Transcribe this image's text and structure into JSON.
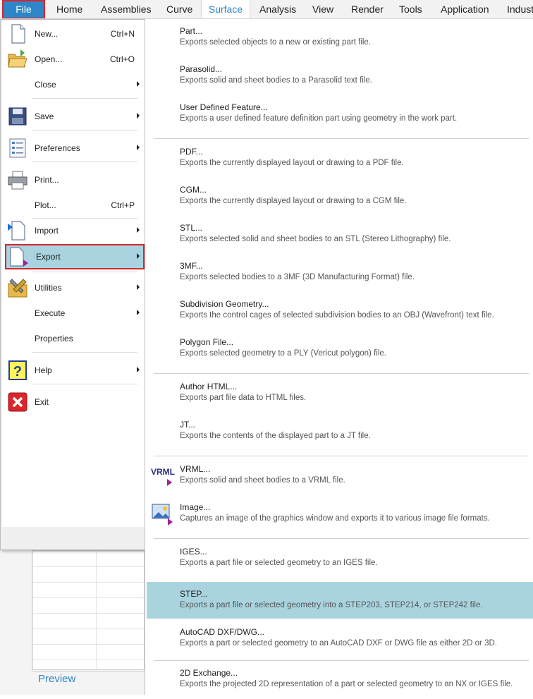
{
  "ribbon": {
    "tabs": [
      {
        "label": "File"
      },
      {
        "label": "Home"
      },
      {
        "label": "Assemblies"
      },
      {
        "label": "Curve"
      },
      {
        "label": "Surface"
      },
      {
        "label": "Analysis"
      },
      {
        "label": "View"
      },
      {
        "label": "Render"
      },
      {
        "label": "Tools"
      },
      {
        "label": "Application"
      },
      {
        "label": "Indust"
      }
    ]
  },
  "file_menu": {
    "items": [
      {
        "label": "New...",
        "shortcut": "Ctrl+N"
      },
      {
        "label": "Open...",
        "shortcut": "Ctrl+O"
      },
      {
        "label": "Close"
      },
      {
        "label": "Save"
      },
      {
        "label": "Preferences"
      },
      {
        "label": "Print..."
      },
      {
        "label": "Plot...",
        "shortcut": "Ctrl+P"
      },
      {
        "label": "Import"
      },
      {
        "label": "Export"
      },
      {
        "label": "Utilities"
      },
      {
        "label": "Execute"
      },
      {
        "label": "Properties"
      },
      {
        "label": "Help"
      },
      {
        "label": "Exit"
      }
    ]
  },
  "export_menu": {
    "items": [
      {
        "title": "Part...",
        "desc": "Exports selected objects to a new or existing part file."
      },
      {
        "title": "Parasolid...",
        "desc": "Exports solid and sheet bodies to a Parasolid text file."
      },
      {
        "title": "User Defined Feature...",
        "desc": "Exports a user defined feature definition part using geometry in the work part."
      },
      {
        "title": "PDF...",
        "desc": "Exports the currently displayed layout or drawing to a PDF file."
      },
      {
        "title": "CGM...",
        "desc": "Exports the currently displayed layout or drawing to a CGM file."
      },
      {
        "title": "STL...",
        "desc": "Exports selected solid and sheet bodies to an STL (Stereo Lithography) file."
      },
      {
        "title": "3MF...",
        "desc": "Exports selected bodies to a 3MF (3D Manufacturing Format) file."
      },
      {
        "title": "Subdivision Geometry...",
        "desc": "Exports the control cages of selected subdivision bodies to an OBJ (Wavefront) text file."
      },
      {
        "title": "Polygon File...",
        "desc": "Exports selected geometry to a PLY (Vericut polygon) file."
      },
      {
        "title": "Author HTML...",
        "desc": "Exports part file data to HTML files."
      },
      {
        "title": "JT...",
        "desc": "Exports the contents of the displayed part to a JT file."
      },
      {
        "title": "VRML...",
        "desc": "Exports solid and sheet bodies to a VRML file."
      },
      {
        "title": "Image...",
        "desc": "Captures an image of the graphics window and exports it to various image file formats."
      },
      {
        "title": "IGES...",
        "desc": "Exports a part file or selected geometry to an IGES file."
      },
      {
        "title": "STEP...",
        "desc": "Exports a part file or selected geometry into a STEP203, STEP214, or STEP242 file."
      },
      {
        "title": "AutoCAD DXF/DWG...",
        "desc": "Exports a part or selected geometry to an AutoCAD DXF or DWG file as either 2D or 3D."
      },
      {
        "title": "2D Exchange...",
        "desc": "Exports the projected 2D representation of a part or selected geometry to an NX or IGES file."
      }
    ],
    "vrml_icon_text": "VRML"
  },
  "background": {
    "preview_label": "Preview"
  },
  "colors": {
    "accent": "#2d86c7",
    "highlight": "#a9d4df",
    "focus_border": "#d9262c"
  }
}
